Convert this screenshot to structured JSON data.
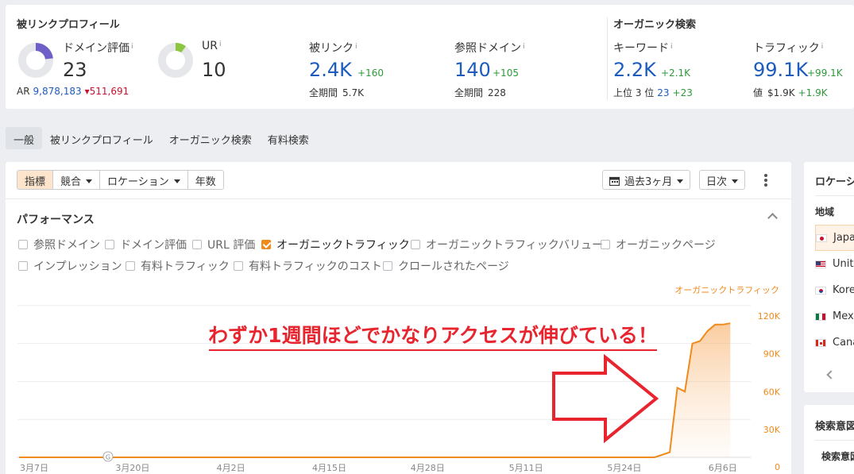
{
  "backlink_profile": {
    "title": "被リンクプロフィール",
    "domain_rating": {
      "label": "ドメイン評価",
      "info": "i",
      "value": "23",
      "gauge_fraction": 0.23
    },
    "ur": {
      "label": "UR",
      "info": "i",
      "value": "10",
      "gauge_fraction": 0.1
    },
    "ar": {
      "label": "AR",
      "value": "9,878,183",
      "delta": "511,691"
    },
    "backlinks": {
      "label": "被リンク",
      "info": "i",
      "value": "2.4K",
      "delta": "+160",
      "sub_label": "全期間",
      "sub_value": "5.7K"
    },
    "ref_domains": {
      "label": "参照ドメイン",
      "info": "i",
      "value": "140",
      "delta": "+105",
      "sub_label": "全期間",
      "sub_value": "228"
    }
  },
  "organic": {
    "title": "オーガニック検索",
    "keywords": {
      "label": "キーワード",
      "info": "i",
      "value": "2.2K",
      "delta": "+2.1K",
      "sub_label": "上位 3 位",
      "sub_value": "23",
      "sub_delta": "+23"
    },
    "traffic": {
      "label": "トラフィック",
      "info": "i",
      "value": "99.1K",
      "delta": "+99.1K",
      "sub_label": "値",
      "sub_value": "$1.9K",
      "sub_delta": "+1.9K"
    }
  },
  "tabs": [
    "一般",
    "被リンクプロフィール",
    "オーガニック検索",
    "有料検索"
  ],
  "toolbar": {
    "segments": [
      "指標",
      "競合",
      "ロケーション",
      "年数"
    ],
    "period": "過去3ヶ月",
    "interval": "日次"
  },
  "performance": {
    "title": "パフォーマンス",
    "checkboxes_row1": [
      {
        "label": "参照ドメイン",
        "checked": false
      },
      {
        "label": "ドメイン評価",
        "checked": false
      },
      {
        "label": "URL 評価",
        "checked": false
      },
      {
        "label": "オーガニックトラフィック",
        "checked": true
      },
      {
        "label": "オーガニックトラフィックバリュー",
        "checked": false
      },
      {
        "label": "オーガニックページ",
        "checked": false
      }
    ],
    "checkboxes_row2": [
      {
        "label": "インプレッション",
        "checked": false
      },
      {
        "label": "有料トラフィック",
        "checked": false
      },
      {
        "label": "有料トラフィックのコスト",
        "checked": false
      },
      {
        "label": "クロールされたページ",
        "checked": false
      }
    ]
  },
  "annotation": {
    "text": "わずか1週間ほどでかなりアクセスが伸びている！",
    "color": "#e8252e"
  },
  "chart_data": {
    "type": "area",
    "series": [
      {
        "name": "オーガニックトラフィック",
        "color": "#f08a1c",
        "x": [
          "3月5日",
          "5月28日",
          "5月30日",
          "5月31日",
          "6月1日",
          "6月2日",
          "6月3日",
          "6月4日",
          "6月5日",
          "6月6日",
          "6月7日"
        ],
        "values": [
          0,
          0,
          4000,
          55000,
          52000,
          90000,
          92000,
          100000,
          105000,
          105000,
          106000
        ]
      }
    ],
    "x_ticks": [
      "3月7日",
      "3月20日",
      "4月2日",
      "4月15日",
      "4月28日",
      "5月11日",
      "5月24日",
      "6月6日"
    ],
    "y_ticks": [
      "0",
      "30K",
      "60K",
      "90K",
      "120K"
    ],
    "ylim": [
      0,
      120000
    ],
    "grid": true,
    "google_marker": "G"
  },
  "right_panel": {
    "title": "ロケーション",
    "subtitle": "地域",
    "countries": [
      "Japan",
      "United States",
      "Korea",
      "Mexico",
      "Canada"
    ],
    "section2_title": "検索意図",
    "section2_row": "検索意図"
  },
  "colors": {
    "accent": "#f08a1c",
    "blue": "#1d5bbf",
    "green": "#2e9a3a",
    "red": "#c8102e"
  }
}
